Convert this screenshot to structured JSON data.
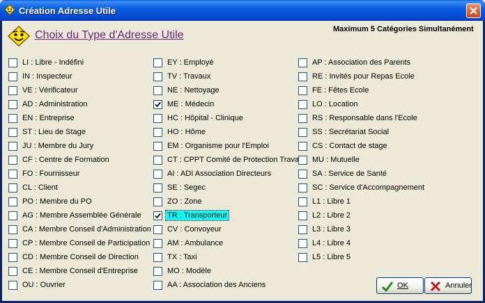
{
  "window": {
    "title": "Création Adresse Utile",
    "close_label": "×"
  },
  "header": {
    "title": "Choix du Type d'Adresse Utile",
    "note": "Maximum 5 Catégories Simultanément"
  },
  "columns": [
    [
      {
        "label": "LI : Libre - Indéfini",
        "checked": false,
        "selected": false
      },
      {
        "label": "IN : Inspecteur",
        "checked": false,
        "selected": false
      },
      {
        "label": "VE : Vérificateur",
        "checked": false,
        "selected": false
      },
      {
        "label": "AD : Administration",
        "checked": false,
        "selected": false
      },
      {
        "label": "EN : Entreprise",
        "checked": false,
        "selected": false
      },
      {
        "label": "ST : Lieu de Stage",
        "checked": false,
        "selected": false
      },
      {
        "label": "JU : Membre du Jury",
        "checked": false,
        "selected": false
      },
      {
        "label": "CF : Centre de Formation",
        "checked": false,
        "selected": false
      },
      {
        "label": "FO : Fournisseur",
        "checked": false,
        "selected": false
      },
      {
        "label": "CL : Client",
        "checked": false,
        "selected": false
      },
      {
        "label": "PO : Membre du PO",
        "checked": false,
        "selected": false
      },
      {
        "label": "AG : Membre Assemblée Générale",
        "checked": false,
        "selected": false
      },
      {
        "label": "CA : Membre Conseil d'Administration",
        "checked": false,
        "selected": false
      },
      {
        "label": "CP : Membre Conseil de Participation",
        "checked": false,
        "selected": false
      },
      {
        "label": "CD : Membre Conseil de Direction",
        "checked": false,
        "selected": false
      },
      {
        "label": "CE : Membre Conseil d'Entreprise",
        "checked": false,
        "selected": false
      },
      {
        "label": "OU : Ouvrier",
        "checked": false,
        "selected": false
      }
    ],
    [
      {
        "label": "EY : Employé",
        "checked": false,
        "selected": false
      },
      {
        "label": "TV : Travaux",
        "checked": false,
        "selected": false
      },
      {
        "label": "NE : Nettoyage",
        "checked": false,
        "selected": false
      },
      {
        "label": "ME : Médecin",
        "checked": true,
        "selected": false
      },
      {
        "label": "HC : Hôpital - Clinique",
        "checked": false,
        "selected": false
      },
      {
        "label": "HO : Hôme",
        "checked": false,
        "selected": false
      },
      {
        "label": "EM : Organisme pour l'Emploi",
        "checked": false,
        "selected": false
      },
      {
        "label": "CT : CPPT Comité de Protection Travail",
        "checked": false,
        "selected": false
      },
      {
        "label": "AI : ADI Association Directeurs",
        "checked": false,
        "selected": false
      },
      {
        "label": "SE : Segec",
        "checked": false,
        "selected": false
      },
      {
        "label": "ZO : Zone",
        "checked": false,
        "selected": false
      },
      {
        "label": "TR : Transporteur",
        "checked": true,
        "selected": true
      },
      {
        "label": "CV : Convoyeur",
        "checked": false,
        "selected": false
      },
      {
        "label": "AM : Ambulance",
        "checked": false,
        "selected": false
      },
      {
        "label": "TX : Taxi",
        "checked": false,
        "selected": false
      },
      {
        "label": "MO : Modèle",
        "checked": false,
        "selected": false
      },
      {
        "label": "AA : Association des Anciens",
        "checked": false,
        "selected": false
      }
    ],
    [
      {
        "label": "AP : Association des Parents",
        "checked": false,
        "selected": false
      },
      {
        "label": "RE : Invités pour Repas Ecole",
        "checked": false,
        "selected": false
      },
      {
        "label": "FE : Fêtes Ecole",
        "checked": false,
        "selected": false
      },
      {
        "label": "LO : Location",
        "checked": false,
        "selected": false
      },
      {
        "label": "RS : Responsable dans l'Ecole",
        "checked": false,
        "selected": false
      },
      {
        "label": "SS : Secrétariat Social",
        "checked": false,
        "selected": false
      },
      {
        "label": "CS : Contact de stage",
        "checked": false,
        "selected": false
      },
      {
        "label": "MU : Mutuelle",
        "checked": false,
        "selected": false
      },
      {
        "label": "SA : Service de Santé",
        "checked": false,
        "selected": false
      },
      {
        "label": "SC : Service d'Accompagnement",
        "checked": false,
        "selected": false
      },
      {
        "label": "L1 : Libre 1",
        "checked": false,
        "selected": false
      },
      {
        "label": "L2 : Libre 2",
        "checked": false,
        "selected": false
      },
      {
        "label": "L3 : Libre 3",
        "checked": false,
        "selected": false
      },
      {
        "label": "L4 : Libre 4",
        "checked": false,
        "selected": false
      },
      {
        "label": "L5 : Libre 5",
        "checked": false,
        "selected": false
      }
    ]
  ],
  "buttons": {
    "ok_label": "OK",
    "cancel_label": "Annuler"
  },
  "colors": {
    "titlebar": "#0a5fe0",
    "face": "#ece9d8",
    "header_title": "#6b1f7c",
    "selection": "#00ffff",
    "ok_check": "#1c8a1c",
    "cancel_x": "#c0141c"
  }
}
